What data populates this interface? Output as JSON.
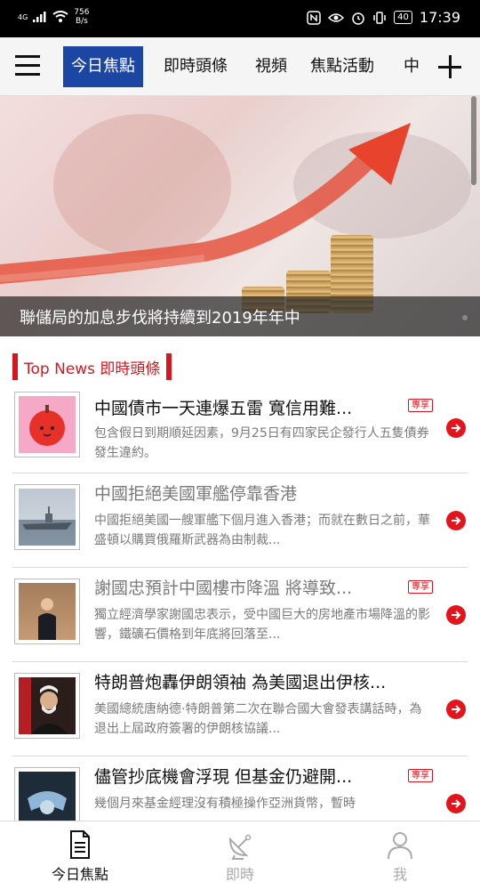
{
  "status_bar": {
    "network": "4G",
    "speed_value": "756",
    "speed_unit": "B/s",
    "battery": "40",
    "time": "17:39"
  },
  "nav": {
    "tabs": [
      {
        "label": "今日焦點",
        "active": true
      },
      {
        "label": "即時頭條"
      },
      {
        "label": "視頻"
      },
      {
        "label": "焦點活動"
      },
      {
        "label": "中"
      }
    ]
  },
  "hero": {
    "caption": "聯儲局的加息步伐將持續到2019年年中"
  },
  "section": {
    "title": "Top News 即時頭條"
  },
  "news": [
    {
      "title": "中國債市一天連爆五雷 寬信用難...",
      "desc": "包含假日到期順延因素，9月25日有四家民企發行人五隻債券發生違約。",
      "badge": "專享",
      "visited": false,
      "thumb": "red-apple-icon"
    },
    {
      "title": "中國拒絕美國軍艦停靠香港",
      "desc": "中國拒絕美國一艘軍艦下個月進入香港；而就在數日之前，華盛頓以購買俄羅斯武器為由制裁...",
      "badge": "",
      "visited": true,
      "thumb": "warship-photo"
    },
    {
      "title": "謝國忠預計中國樓市降溫 將導致...",
      "desc": "獨立經濟學家謝國忠表示，受中國巨大的房地產市場降溫的影響，鐵礦石價格到年底將回落至...",
      "badge": "專享",
      "visited": true,
      "thumb": "speaker-photo"
    },
    {
      "title": "特朗普炮轟伊朗領袖 為美國退出伊核...",
      "desc": "美國總統唐納德·特朗普第二次在聯合國大會發表講話時，為退出上屆政府簽署的伊朗核協議...",
      "badge": "",
      "visited": false,
      "thumb": "portrait-photo"
    },
    {
      "title": "儘管抄底機會浮現 但基金仍避開...",
      "desc": "幾個月來基金經理沒有積極操作亞洲貨幣，暫時",
      "badge": "專享",
      "visited": false,
      "thumb": "statue-photo"
    }
  ],
  "bottom_nav": [
    {
      "label": "今日焦點",
      "icon": "document-icon",
      "active": true
    },
    {
      "label": "即時",
      "icon": "satellite-icon",
      "active": false
    },
    {
      "label": "我",
      "icon": "user-icon",
      "active": false
    }
  ],
  "colors": {
    "brand_blue": "#1b46a4",
    "accent_red": "#d6161e"
  }
}
